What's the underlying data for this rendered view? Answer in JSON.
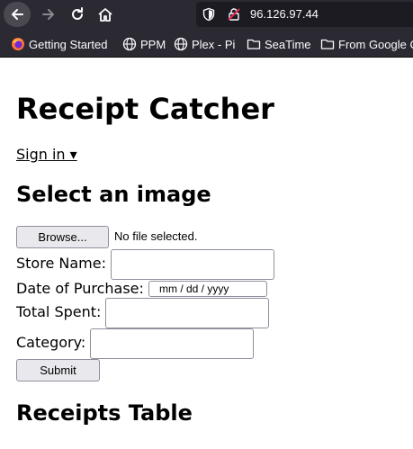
{
  "browser": {
    "url": "96.126.97.44",
    "bookmarks": [
      {
        "label": "Getting Started",
        "icon": "firefox-icon"
      },
      {
        "label": "PPM",
        "icon": "globe-icon"
      },
      {
        "label": "Plex - Pi",
        "icon": "globe-icon"
      },
      {
        "label": "SeaTime",
        "icon": "folder-icon"
      },
      {
        "label": "From Google C",
        "icon": "folder-icon"
      }
    ]
  },
  "page": {
    "title": "Receipt Catcher",
    "sign_in": "Sign in ▾",
    "upload_heading": "Select an image",
    "browse_label": "Browse...",
    "file_status": "No file selected.",
    "store_label": "Store Name:",
    "store_value": "",
    "date_label": "Date of Purchase:",
    "date_placeholder": "mm / dd / yyyy",
    "total_label": "Total Spent:",
    "total_value": "",
    "category_label": "Category:",
    "category_value": "",
    "submit_label": "Submit",
    "table_heading": "Receipts Table"
  },
  "colors": {
    "chrome_bg": "#2b2a33",
    "urlbar_bg": "#1c1b22",
    "button_bg": "#e9e9ed",
    "input_border": "#8f8f9d"
  }
}
